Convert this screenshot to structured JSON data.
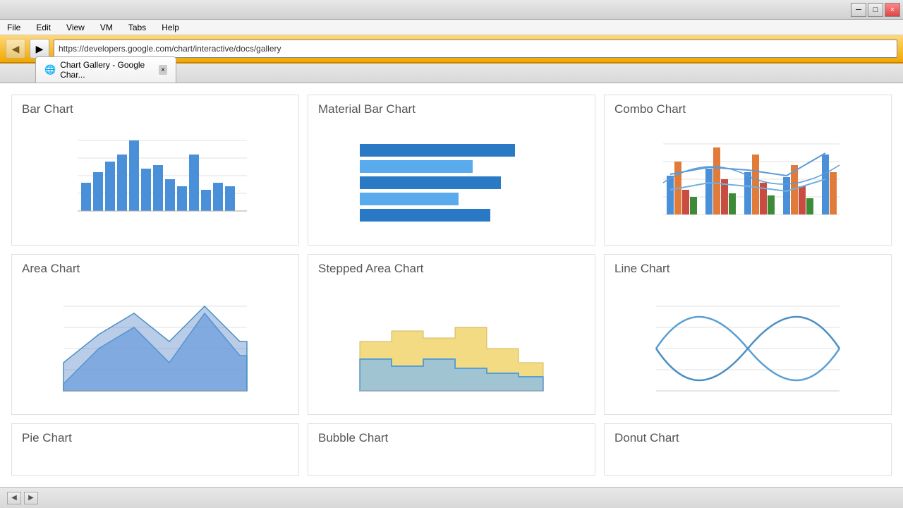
{
  "browser": {
    "title": "Chart Gallery - Google Char...",
    "url": "https://developers.google.com/chart/interactive/docs/gallery",
    "menu_items": [
      "File",
      "Edit",
      "View",
      "VM",
      "Tabs",
      "Help"
    ],
    "tab_icon": "🌐",
    "tab_close": "×",
    "btn_back": "◀",
    "btn_forward": "▶",
    "btn_minimize": "─",
    "btn_maximize": "□",
    "btn_close": "×"
  },
  "charts": [
    {
      "id": "bar-chart",
      "title": "Bar Chart",
      "type": "bar"
    },
    {
      "id": "material-bar-chart",
      "title": "Material Bar Chart",
      "type": "material-bar"
    },
    {
      "id": "combo-chart",
      "title": "Combo Chart",
      "type": "combo"
    },
    {
      "id": "area-chart",
      "title": "Area Chart",
      "type": "area"
    },
    {
      "id": "stepped-area-chart",
      "title": "Stepped Area Chart",
      "type": "stepped-area"
    },
    {
      "id": "line-chart",
      "title": "Line Chart",
      "type": "line"
    },
    {
      "id": "pie-chart",
      "title": "Pie Chart",
      "type": "pie"
    },
    {
      "id": "bubble-chart",
      "title": "Bubble Chart",
      "type": "bubble"
    },
    {
      "id": "donut-chart",
      "title": "Donut Chart",
      "type": "donut"
    }
  ],
  "status": {
    "left": "",
    "scroll_left": "◀",
    "scroll_right": "▶"
  }
}
